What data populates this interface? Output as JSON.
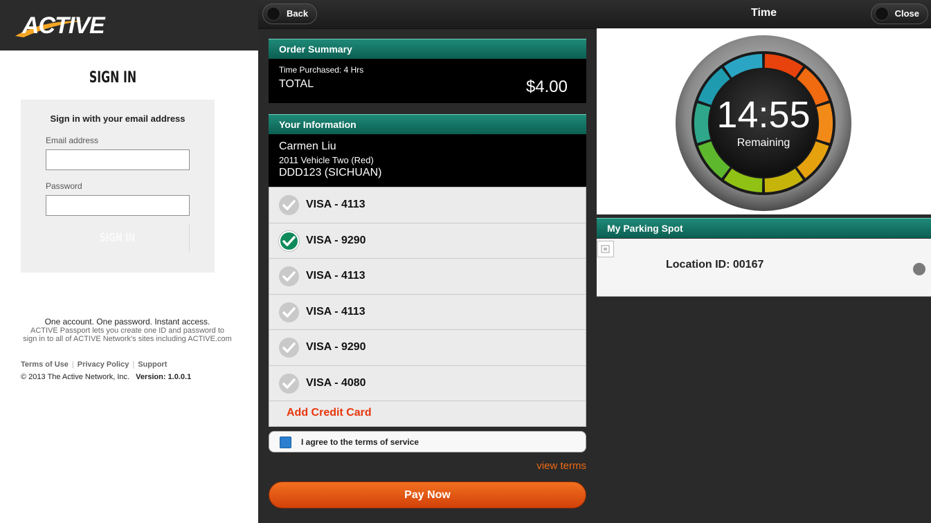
{
  "signin": {
    "brand": "ACTIVE",
    "title": "SIGN IN",
    "subtitle": "Sign in with your email address",
    "email_label": "Email address",
    "email_value": "",
    "password_label": "Password",
    "password_value": "",
    "button_label": "SIGN IN",
    "tagline": "One account. One password. Instant access.",
    "description_line1": "ACTIVE Passport lets you create one ID and password to",
    "description_line2": "sign in to all of ACTIVE Network's sites including ACTIVE.com",
    "links": [
      "Terms of Use",
      "Privacy Policy",
      "Support"
    ],
    "copyright": "© 2013 The Active Network, Inc.",
    "version": "Version: 1.0.0.1"
  },
  "checkout": {
    "back_label": "Back",
    "order_summary_title": "Order Summary",
    "time_purchased": "Time Purchased: 4 Hrs",
    "total_label": "TOTAL",
    "total_value": "$4.00",
    "your_info_title": "Your Information",
    "name": "Carmen Liu",
    "vehicle": "2011 Vehicle Two (Red)",
    "plate": "DDD123 (SICHUAN)",
    "cards": [
      {
        "label": "VISA - 4113",
        "selected": false
      },
      {
        "label": "VISA - 9290",
        "selected": true
      },
      {
        "label": "VISA - 4113",
        "selected": false
      },
      {
        "label": "VISA - 4113",
        "selected": false
      },
      {
        "label": "VISA - 9290",
        "selected": false
      },
      {
        "label": "VISA - 4080",
        "selected": false
      }
    ],
    "add_card_label": "Add Credit Card",
    "agree_label": "I agree to the terms of service",
    "view_terms_label": "view terms",
    "pay_label": "Pay Now"
  },
  "timer": {
    "title": "Time",
    "close_label": "Close",
    "time_remaining": "14:55",
    "remaining_label": "Remaining",
    "spot_title": "My Parking Spot",
    "location": "Location ID: 00167"
  },
  "colors": {
    "teal": "#0b6e5f",
    "orange": "#e8500f",
    "selected_check": "#0f8a5a"
  }
}
